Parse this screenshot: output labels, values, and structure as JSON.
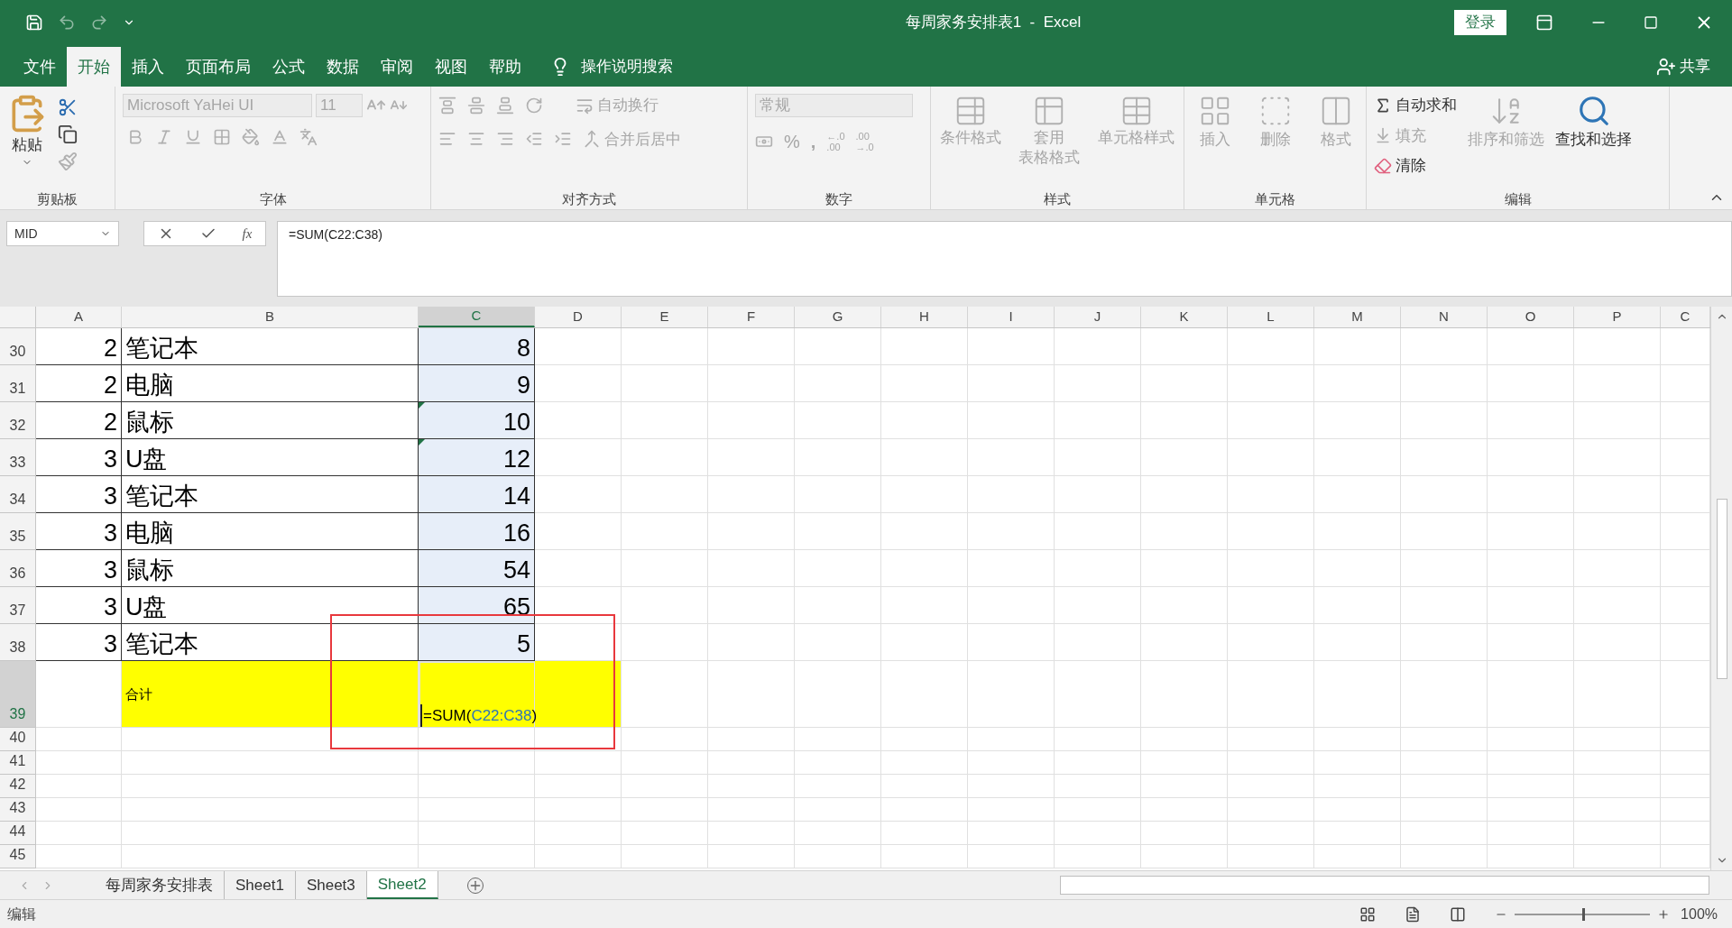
{
  "window": {
    "title": "每周家务安排表1  -  Excel",
    "sign_in": "登录"
  },
  "menu_tabs": [
    {
      "label": "文件",
      "selected": false
    },
    {
      "label": "开始",
      "selected": true
    },
    {
      "label": "插入",
      "selected": false
    },
    {
      "label": "页面布局",
      "selected": false
    },
    {
      "label": "公式",
      "selected": false
    },
    {
      "label": "数据",
      "selected": false
    },
    {
      "label": "审阅",
      "selected": false
    },
    {
      "label": "视图",
      "selected": false
    },
    {
      "label": "帮助",
      "selected": false
    }
  ],
  "tell_me": "操作说明搜索",
  "share": "共享",
  "ribbon": {
    "clipboard": {
      "label": "剪贴板",
      "paste": "粘贴"
    },
    "font": {
      "label": "字体",
      "font_name": "Microsoft YaHei UI",
      "font_size": "11",
      "disabled": true
    },
    "alignment": {
      "label": "对齐方式",
      "wrap_text": "自动换行",
      "merge": "合并后居中",
      "disabled": true
    },
    "number": {
      "label": "数字",
      "format": "常规",
      "percent": "%",
      "comma": ",",
      "decimals": [
        {
          "top": "←.0",
          "bottom": ".00"
        },
        {
          "top": ".00",
          "bottom": "→.0"
        }
      ],
      "disabled": true
    },
    "styles": {
      "label": "样式",
      "buttons": [
        {
          "lines": [
            "条件格式"
          ],
          "disabled": true
        },
        {
          "lines": [
            "套用",
            "表格格式"
          ],
          "disabled": true
        },
        {
          "lines": [
            "单元格样式"
          ],
          "disabled": true
        }
      ]
    },
    "cells": {
      "label": "单元格",
      "buttons": [
        {
          "lines": [
            "插入"
          ],
          "disabled": true
        },
        {
          "lines": [
            "删除"
          ],
          "disabled": true
        },
        {
          "lines": [
            "格式"
          ],
          "disabled": true
        }
      ]
    },
    "editing": {
      "label": "编辑",
      "autosum": {
        "label": "自动求和",
        "disabled": false
      },
      "fill": {
        "label": "填充",
        "disabled": true
      },
      "clear": {
        "label": "清除",
        "disabled": false
      },
      "sort": {
        "label": "排序和筛选",
        "disabled": true
      },
      "find": {
        "label": "查找和选择",
        "disabled": false
      }
    }
  },
  "formula_bar": {
    "name_box": "MID",
    "function_button": "fx",
    "formula": "=SUM(C22:C38)"
  },
  "columns": [
    {
      "label": "A",
      "selected": false
    },
    {
      "label": "B",
      "selected": false
    },
    {
      "label": "C",
      "selected": true
    },
    {
      "label": "D",
      "selected": false
    },
    {
      "label": "E",
      "selected": false
    },
    {
      "label": "F",
      "selected": false
    },
    {
      "label": "G",
      "selected": false
    },
    {
      "label": "H",
      "selected": false
    },
    {
      "label": "I",
      "selected": false
    },
    {
      "label": "J",
      "selected": false
    },
    {
      "label": "K",
      "selected": false
    },
    {
      "label": "L",
      "selected": false
    },
    {
      "label": "M",
      "selected": false
    },
    {
      "label": "N",
      "selected": false
    },
    {
      "label": "O",
      "selected": false
    },
    {
      "label": "P",
      "selected": false
    },
    {
      "label": "C",
      "selected": false
    }
  ],
  "rows": [
    {
      "number": "30",
      "selected": false,
      "kind": "data",
      "a": "2",
      "b": "笔记本",
      "c": "8",
      "in_range": true,
      "error_flag": false
    },
    {
      "number": "31",
      "selected": false,
      "kind": "data",
      "a": "2",
      "b": "电脑",
      "c": "9",
      "in_range": true,
      "error_flag": false
    },
    {
      "number": "32",
      "selected": false,
      "kind": "data",
      "a": "2",
      "b": "鼠标",
      "c": "10",
      "in_range": true,
      "error_flag": true
    },
    {
      "number": "33",
      "selected": false,
      "kind": "data",
      "a": "3",
      "b": "U盘",
      "c": "12",
      "in_range": true,
      "error_flag": true
    },
    {
      "number": "34",
      "selected": false,
      "kind": "data",
      "a": "3",
      "b": "笔记本",
      "c": "14",
      "in_range": true,
      "error_flag": false
    },
    {
      "number": "35",
      "selected": false,
      "kind": "data",
      "a": "3",
      "b": "电脑",
      "c": "16",
      "in_range": true,
      "error_flag": false
    },
    {
      "number": "36",
      "selected": false,
      "kind": "data",
      "a": "3",
      "b": "鼠标",
      "c": "54",
      "in_range": true,
      "error_flag": false
    },
    {
      "number": "37",
      "selected": false,
      "kind": "data",
      "a": "3",
      "b": "U盘",
      "c": "65",
      "in_range": true,
      "error_flag": false
    },
    {
      "number": "38",
      "selected": false,
      "kind": "data",
      "a": "3",
      "b": "笔记本",
      "c": "5",
      "in_range": true,
      "error_flag": false
    },
    {
      "number": "39",
      "selected": true,
      "kind": "total",
      "highlighted": true,
      "b": "合计",
      "edit": {
        "before": "=SUM(",
        "ref": "C22:C38",
        "after": ")"
      }
    },
    {
      "number": "40",
      "selected": false,
      "kind": "empty"
    },
    {
      "number": "41",
      "selected": false,
      "kind": "empty"
    },
    {
      "number": "42",
      "selected": false,
      "kind": "empty"
    },
    {
      "number": "43",
      "selected": false,
      "kind": "empty"
    },
    {
      "number": "44",
      "selected": false,
      "kind": "empty"
    },
    {
      "number": "45",
      "selected": false,
      "kind": "empty"
    }
  ],
  "sheet_tabs": [
    {
      "label": "每周家务安排表",
      "selected": false
    },
    {
      "label": "Sheet1",
      "selected": false
    },
    {
      "label": "Sheet3",
      "selected": false
    },
    {
      "label": "Sheet2",
      "selected": true
    }
  ],
  "status_bar": {
    "mode": "编辑",
    "zoom": "100%",
    "zoom_slider": {
      "level": 0.5
    }
  }
}
